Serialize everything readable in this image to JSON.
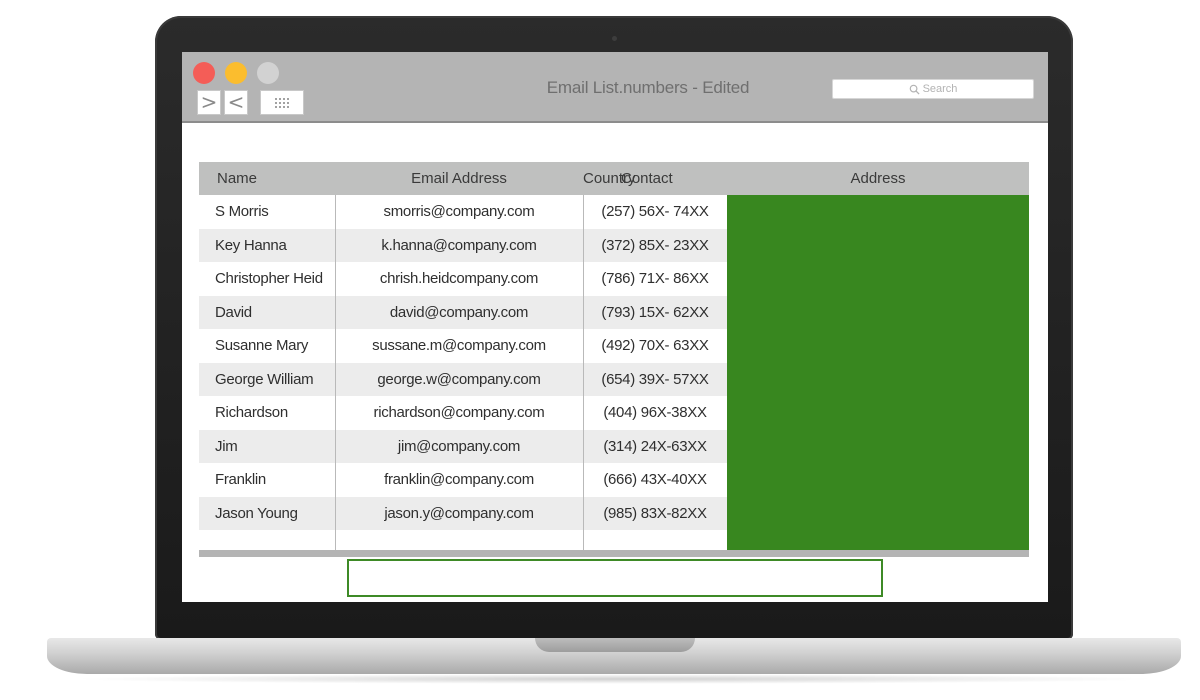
{
  "window": {
    "title": "Email List.numbers - Edited",
    "nav_forward": ">",
    "nav_back": "<"
  },
  "search": {
    "placeholder": "Search"
  },
  "table": {
    "headers": {
      "name": "Name",
      "email": "Email Address",
      "country": "Country",
      "contact": "Contact",
      "address": "Address"
    },
    "rows": [
      {
        "name": "S Morris",
        "email": "smorris@company.com",
        "contact": "(257) 56X- 74XX"
      },
      {
        "name": "Key Hanna",
        "email": "k.hanna@company.com",
        "contact": "(372) 85X- 23XX"
      },
      {
        "name": "Christopher Heid",
        "email": "chrish.heidcompany.com",
        "contact": "(786) 71X- 86XX"
      },
      {
        "name": "David",
        "email": "david@company.com",
        "contact": "(793) 15X- 62XX"
      },
      {
        "name": "Susanne Mary",
        "email": "sussane.m@company.com",
        "contact": "(492) 70X- 63XX"
      },
      {
        "name": "George William",
        "email": "george.w@company.com",
        "contact": "(654) 39X- 57XX"
      },
      {
        "name": "Richardson",
        "email": "richardson@company.com",
        "contact": "(404) 96X-38XX"
      },
      {
        "name": "Jim",
        "email": "jim@company.com",
        "contact": "(314) 24X-63XX"
      },
      {
        "name": "Franklin",
        "email": "franklin@company.com",
        "contact": "(666) 43X-40XX"
      },
      {
        "name": "Jason Young",
        "email": "jason.y@company.com",
        "contact": "(985) 83X-82XX"
      }
    ]
  },
  "colors": {
    "address_highlight": "#38871f",
    "selection_border": "#3e8a26",
    "titlebar": "#b4b4b4"
  },
  "icons": {
    "close": "red-close-dot-icon",
    "minimize": "yellow-minimize-dot-icon",
    "zoom": "gray-zoom-dot-icon",
    "grid": "grid-view-icon",
    "search": "search-icon"
  }
}
